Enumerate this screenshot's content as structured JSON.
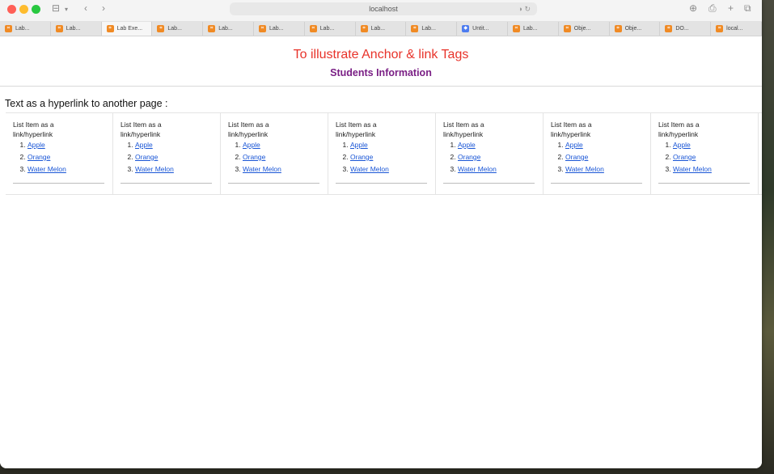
{
  "browser": {
    "address": "localhost",
    "tabs": [
      {
        "label": "Lab...",
        "icon": "html-file-icon",
        "active": false
      },
      {
        "label": "Lab...",
        "icon": "html-file-icon",
        "active": false
      },
      {
        "label": "Lab Exe...",
        "icon": "html-file-icon",
        "active": true
      },
      {
        "label": "Lab...",
        "icon": "html-file-icon",
        "active": false
      },
      {
        "label": "Lab...",
        "icon": "html-file-icon",
        "active": false
      },
      {
        "label": "Lab...",
        "icon": "html-file-icon",
        "active": false
      },
      {
        "label": "Lab...",
        "icon": "html-file-icon",
        "active": false
      },
      {
        "label": "Lab...",
        "icon": "html-file-icon",
        "active": false
      },
      {
        "label": "Lab...",
        "icon": "html-file-icon",
        "active": false
      },
      {
        "label": "Untit...",
        "icon": "app-icon",
        "active": false
      },
      {
        "label": "Lab...",
        "icon": "html-file-icon",
        "active": false
      },
      {
        "label": "Obje...",
        "icon": "html-file-icon",
        "active": false
      },
      {
        "label": "Obje...",
        "icon": "html-file-icon",
        "active": false
      },
      {
        "label": "DO...",
        "icon": "html-file-icon",
        "active": false
      },
      {
        "label": "local...",
        "icon": "html-file-icon",
        "active": false
      }
    ]
  },
  "page": {
    "title": "To illustrate Anchor & link Tags",
    "subtitle": "Students Information",
    "section_title": "Text as a hyperlink to another page :",
    "card_label": "List Item as a link/hyperlink",
    "links": [
      "Apple",
      "Orange",
      "Water Melon"
    ],
    "card_count": 7
  },
  "colors": {
    "title": "#e8332a",
    "subtitle": "#7a1f85",
    "link": "#1a56d6"
  }
}
